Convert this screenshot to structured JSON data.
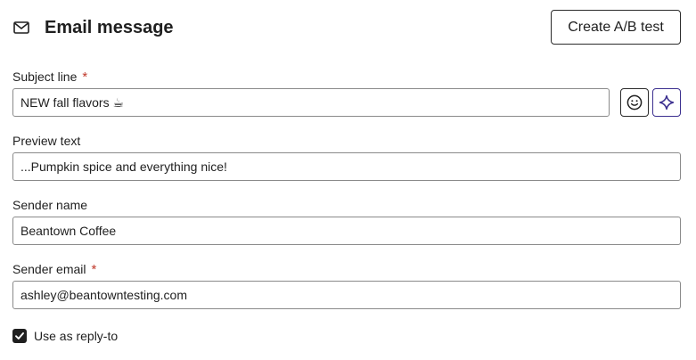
{
  "header": {
    "icon": "envelope-icon",
    "title": "Email message",
    "ab_button_label": "Create A/B test"
  },
  "fields": {
    "subject": {
      "label": "Subject line",
      "required_marker": "*",
      "value": "NEW fall flavors ☕"
    },
    "preview": {
      "label": "Preview text",
      "value": "...Pumpkin spice and everything nice!"
    },
    "sender_name": {
      "label": "Sender name",
      "value": "Beantown Coffee"
    },
    "sender_email": {
      "label": "Sender email",
      "required_marker": "*",
      "value": "ashley@beantowntesting.com"
    }
  },
  "subject_tools": {
    "emoji_icon": "smiley-icon",
    "ai_icon": "sparkle-icon"
  },
  "reply_to": {
    "label": "Use as reply-to",
    "checked": true
  },
  "colors": {
    "text": "#1f1f1f",
    "required": "#c0392b",
    "ai_accent": "#3b2f8f",
    "border": "#8a8a8a"
  }
}
